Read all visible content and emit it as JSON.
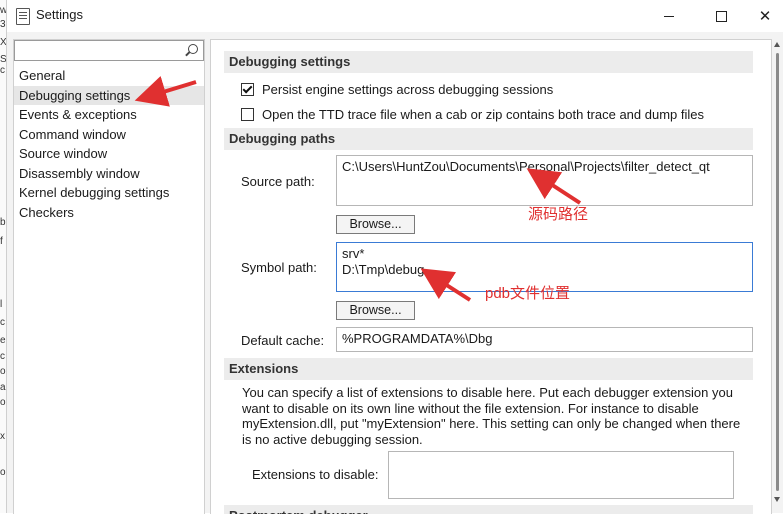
{
  "window": {
    "title": "Settings"
  },
  "titlebar_buttons": {
    "close_glyph": "✕"
  },
  "search": {
    "placeholder": ""
  },
  "nav": {
    "items": [
      {
        "label": "General"
      },
      {
        "label": "Debugging settings",
        "selected": true
      },
      {
        "label": "Events & exceptions"
      },
      {
        "label": "Command window"
      },
      {
        "label": "Source window"
      },
      {
        "label": "Disassembly window"
      },
      {
        "label": "Kernel debugging settings"
      },
      {
        "label": "Checkers"
      }
    ]
  },
  "debugging_settings": {
    "header": "Debugging settings",
    "persist_label": "Persist engine settings across debugging sessions",
    "persist_checked": true,
    "ttd_label": "Open the TTD trace file when a cab or zip contains both trace and dump files",
    "ttd_checked": false
  },
  "debugging_paths": {
    "header": "Debugging paths",
    "source_label": "Source path:",
    "source_value": "C:\\Users\\HuntZou\\Documents\\Personal\\Projects\\filter_detect_qt",
    "browse_label": "Browse...",
    "symbol_label": "Symbol path:",
    "symbol_value": "srv*\nD:\\Tmp\\debug",
    "default_cache_label": "Default cache:",
    "default_cache_value": "%PROGRAMDATA%\\Dbg"
  },
  "extensions": {
    "header": "Extensions",
    "description": "You can specify a list of extensions to disable here. Put each debugger extension you want to disable on its own line without the file extension. For instance to disable myExtension.dll, put \"myExtension\" here. This setting can only be changed when there is no active debugging session.",
    "disable_label": "Extensions to disable:",
    "disable_value": ""
  },
  "postmortem": {
    "header": "Postmortem debugger"
  },
  "annotations": {
    "source_note": "源码路径",
    "pdb_note": "pdb文件位置",
    "arrow_color": "#e03030"
  },
  "background_window_glyphs": [
    "w",
    "3",
    "X",
    "S",
    "c",
    "b",
    "f",
    "l",
    "c",
    "e",
    "c",
    "o",
    "a",
    "o",
    "x",
    "o"
  ]
}
